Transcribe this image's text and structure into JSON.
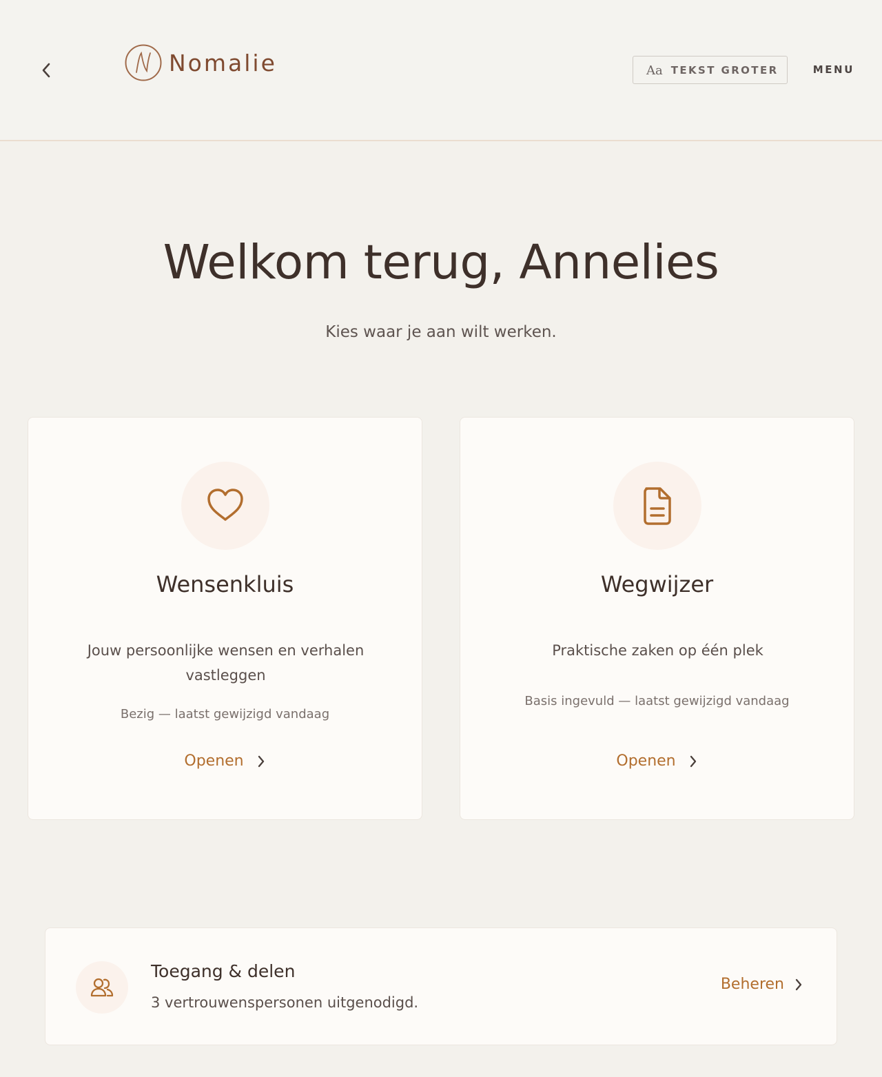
{
  "header": {
    "back_icon": "chevron-left-icon",
    "logo_text": "Nomalie",
    "text_size": {
      "icon_text": "Aa",
      "label": "TEKST GROTER"
    },
    "menu_label": "MENU"
  },
  "hero": {
    "title": "Welkom terug, Annelies",
    "subtitle": "Kies waar je aan wilt werken."
  },
  "cards": [
    {
      "icon": "heart-icon",
      "title": "Wensenkluis",
      "description": "Jouw persoonlijke wensen en verhalen vastleggen",
      "status": "Bezig — laatst gewijzigd vandaag",
      "link_label": "Openen"
    },
    {
      "icon": "document-icon",
      "title": "Wegwijzer",
      "description": "Praktische zaken op één plek",
      "status": "Basis ingevuld — laatst gewijzigd vandaag",
      "link_label": "Openen"
    }
  ],
  "access": {
    "icon": "users-icon",
    "title": "Toegang & delen",
    "subtitle": "3 vertrouwenspersonen uitgenodigd.",
    "link_label": "Beheren"
  },
  "colors": {
    "accent": "#b26e2e",
    "background": "#f3f1ec",
    "card": "#fdfbf8",
    "icon_circle": "#fbf2ec",
    "text_dark": "#3e302a"
  }
}
